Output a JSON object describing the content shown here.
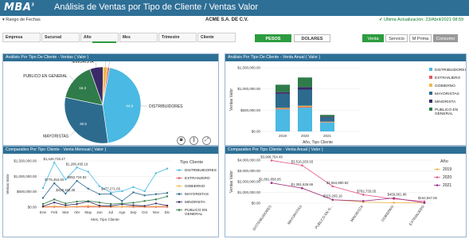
{
  "header": {
    "logo": "MBA",
    "logo_sup": "3",
    "title": "Análisis de Ventas por Tipo de Cliente / Ventas Valor"
  },
  "subbar": {
    "range_label": "Rango de Fechas",
    "company": "ACME S.A. DE C.V.",
    "update": "Ultima Actualización: 23/Abril/2021 08:59"
  },
  "filters": [
    {
      "label": "Empresa"
    },
    {
      "label": "Sucursal"
    },
    {
      "label": "Año"
    },
    {
      "label": "Mes"
    },
    {
      "label": "Trimestre"
    },
    {
      "label": "Cliente"
    }
  ],
  "currency": {
    "pesos": "PESOS",
    "dolares": "DOLARES",
    "selected": "PESOS"
  },
  "views": [
    {
      "label": "Venta",
      "selected": true
    },
    {
      "label": "Servicio"
    },
    {
      "label": "M Prima"
    },
    {
      "label": "Consumo"
    }
  ],
  "colors": {
    "DISTRIBUIDORES": "#4ab9e3",
    "EXTRANJERO": "#e05a5a",
    "GOBIERNO": "#f1b84a",
    "MAYORISTAS": "#2d6b8e",
    "MINORISTA": "#3a2a68",
    "PUBLICO EN GENERAL": "#2f7c4a"
  },
  "panels": {
    "pie_title": "Análisis Por Tipo De Cliente - Ventas ( Valor )",
    "stack_title": "Análisis Por Tipo De Cliente - Venta Anual ( Valor )",
    "monthly_title": "Comparativo Por Tipo Cliente - Venta Mensual ( Valor )",
    "yearly_title": "Comparativo Por Tipo Cliente - Venta Anual ( Valor )"
  },
  "chart_data": [
    {
      "type": "pie",
      "categories": [
        "DISTRIBUIDORES",
        "MAYORISTAS",
        "PUBLICO EN GENERAL",
        "MINORISTA",
        "GOBIERNO",
        "EXTRANJERO"
      ],
      "values": [
        44.9,
        30.5,
        16.3,
        5.6,
        1.9,
        0.8
      ],
      "value_labels": [
        "44.9",
        "30.5",
        "16.3",
        "",
        "",
        ""
      ]
    },
    {
      "type": "bar",
      "categories": [
        "2019",
        "2020",
        "2021"
      ],
      "xlabel": "Año, Tipo Cliente",
      "ylabel": "Ventas Valor",
      "yticks": [
        "$0.00",
        "$500,000.00",
        "$1,000,000.00",
        "$1,500,000.00"
      ],
      "ylim": [
        0,
        1500000
      ],
      "series": [
        {
          "name": "DISTRIBUIDORES",
          "values": [
            520000,
            560000,
            210000
          ]
        },
        {
          "name": "EXTRANJERO",
          "values": [
            15000,
            20000,
            10000
          ]
        },
        {
          "name": "GOBIERNO",
          "values": [
            20000,
            25000,
            10000
          ]
        },
        {
          "name": "MAYORISTAS",
          "values": [
            330000,
            380000,
            100000
          ]
        },
        {
          "name": "MINORISTA",
          "values": [
            40000,
            60000,
            20000
          ]
        },
        {
          "name": "PUBLICO EN GENERAL",
          "values": [
            175000,
            225000,
            40000
          ]
        }
      ]
    },
    {
      "type": "line",
      "categories": [
        "Ene",
        "Feb",
        "Mar",
        "Abr",
        "May",
        "Jun",
        "Jul",
        "Ago",
        "Sep",
        "Oct",
        "Nov",
        "Dic"
      ],
      "xlabel": "Mes, Tipo Cliente",
      "ylabel": "Ventas Valor",
      "legend_title": "Tipo Cliente",
      "yticks": [
        "$0.00",
        "$500,000.00",
        "$1,000,000.00",
        "$1,500,000.00"
      ],
      "ylim": [
        0,
        1500000
      ],
      "series": [
        {
          "name": "DISTRIBUIDORES",
          "values": [
            620000,
            1446728,
            900000,
            1286495,
            1150000,
            680000,
            477271,
            520000,
            650000,
            520000,
            1100000,
            1250000
          ]
        },
        {
          "name": "EXTRANJERO",
          "values": [
            5000,
            8000,
            5000,
            10000,
            5000,
            8000,
            5000,
            10000,
            8000,
            5000,
            5000,
            5000
          ]
        },
        {
          "name": "GOBIERNO",
          "values": [
            20000,
            30000,
            15000,
            20000,
            40000,
            30000,
            20000,
            15000,
            30000,
            20000,
            25000,
            30000
          ]
        },
        {
          "name": "MAYORISTAS",
          "values": [
            300000,
            775353,
            438182,
            852724,
            600000,
            420000,
            430000,
            200000,
            480000,
            380000,
            420000,
            460000
          ]
        },
        {
          "name": "MINORISTA",
          "values": [
            30000,
            150000,
            60000,
            100000,
            180000,
            50000,
            40000,
            90000,
            60000,
            40000,
            120000,
            50000
          ]
        },
        {
          "name": "PUBLICO EN GENERAL",
          "values": [
            100000,
            250000,
            120000,
            180000,
            200000,
            150000,
            100000,
            120000,
            140000,
            200000,
            250000,
            350000
          ]
        }
      ],
      "data_labels": [
        "$1,446,728.47",
        "$1,286,495.19",
        "$775,353.83",
        "$852,724.81",
        "$438,182.38",
        "$477,271.65"
      ]
    },
    {
      "type": "line",
      "categories": [
        "DISTRIBUIDORES",
        "MAYORISTAS",
        "PUBLICO EN G...",
        "MINORISTA",
        "GOBIERNO",
        "EXTRANJERO"
      ],
      "ylabel": "Ventas Valor",
      "legend_title": "Año",
      "yticks": [
        "$0.00",
        "$1,000,000.00",
        "$2,000,000.00",
        "$3,000,000.00",
        "$4,000,000.00"
      ],
      "ylim": [
        0,
        4000000
      ],
      "series": [
        {
          "name": "2019",
          "values": [
            1881858,
            1391636,
            315265,
            100000,
            40000,
            20000
          ]
        },
        {
          "name": "2020",
          "values": [
            3968764,
            3516283,
            1564880,
            782735,
            400000,
            162557
          ]
        },
        {
          "name": "2021",
          "values": [
            1881858,
            1391636,
            315265,
            200000,
            469861,
            30000
          ]
        }
      ],
      "series_colors": [
        "#f1b84a",
        "#e05a8c",
        "#9b2f8f"
      ],
      "data_labels": [
        "$3,968,764.49",
        "$3,516,283.93",
        "$1,881,858.95",
        "$1,391,636.66",
        "$1,564,880.82",
        "$315,265.16",
        "$782,735.05",
        "$469,861.88",
        "$162,557.06"
      ]
    }
  ]
}
